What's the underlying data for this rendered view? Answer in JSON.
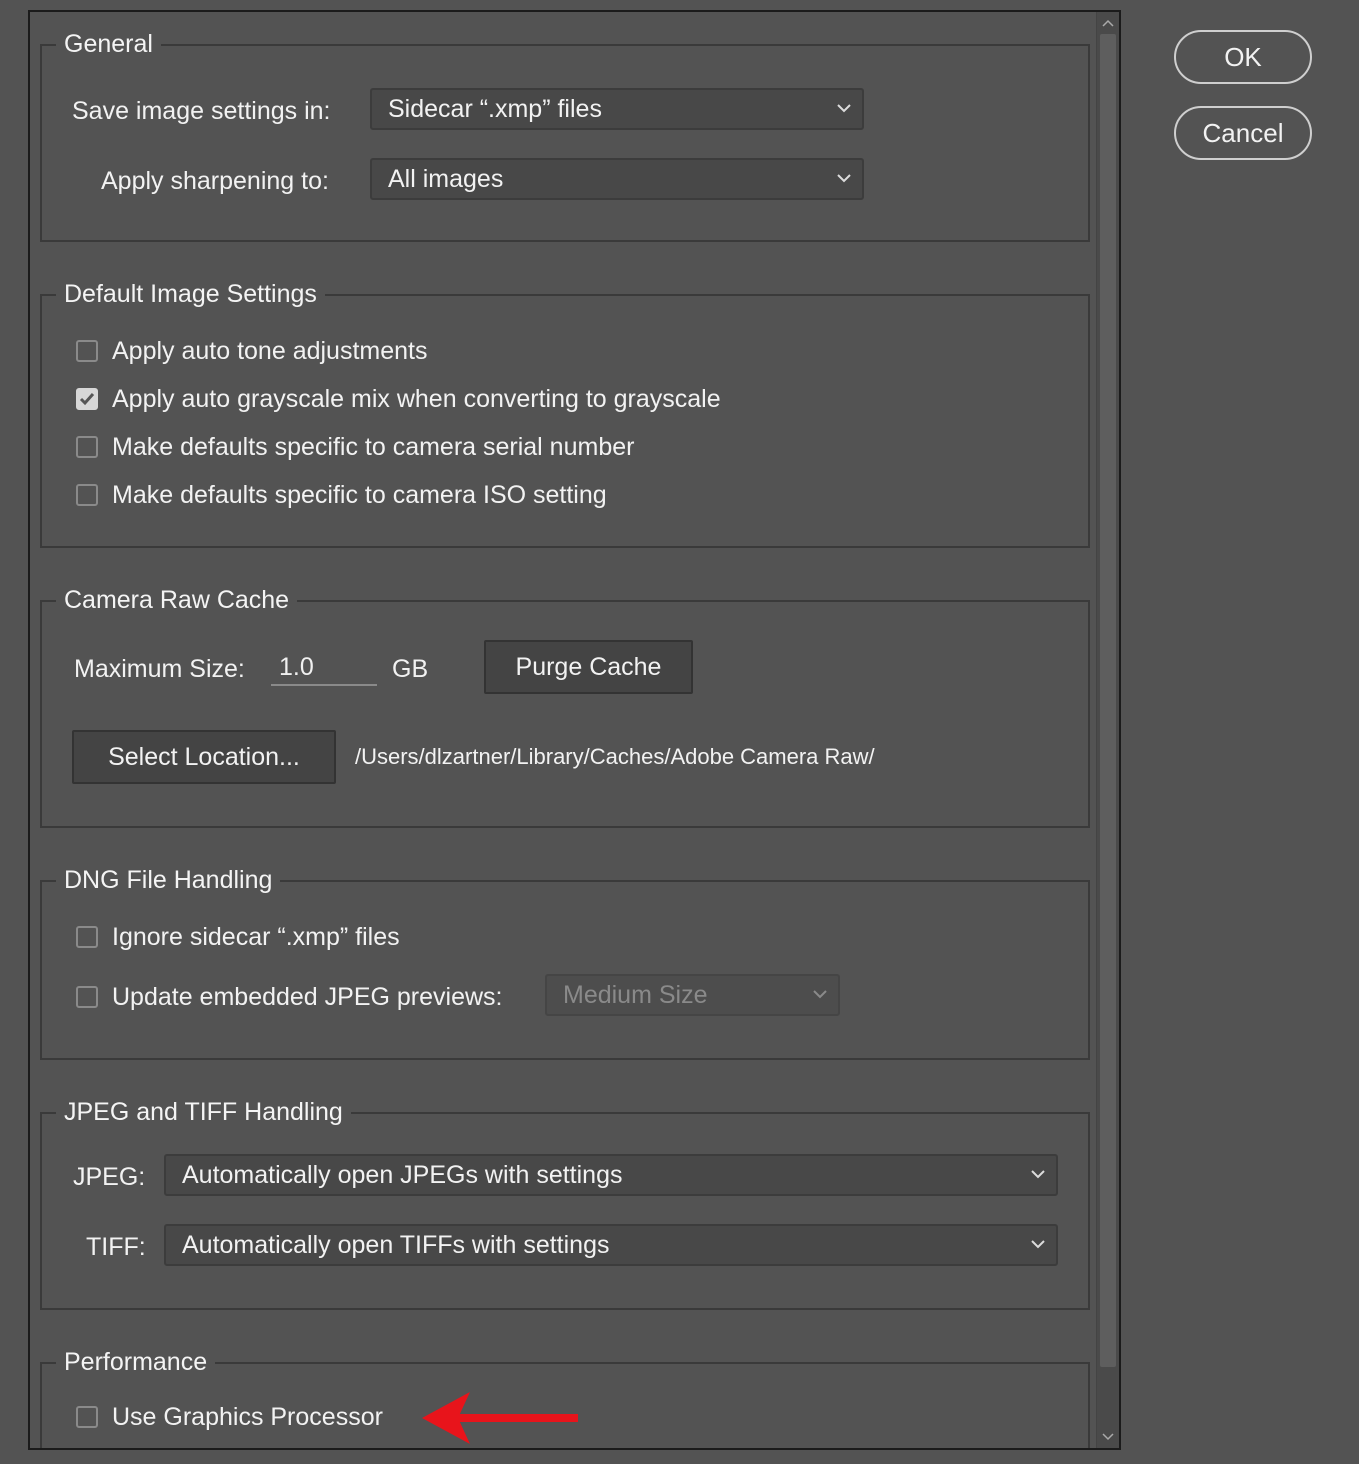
{
  "dialog_buttons": {
    "ok": "OK",
    "cancel": "Cancel"
  },
  "general": {
    "title": "General",
    "save_label": "Save image settings in:",
    "save_value": "Sidecar “.xmp” files",
    "sharpen_label": "Apply sharpening to:",
    "sharpen_value": "All images"
  },
  "default_image": {
    "title": "Default Image Settings",
    "options": [
      {
        "label": "Apply auto tone adjustments",
        "checked": false
      },
      {
        "label": "Apply auto grayscale mix when converting to grayscale",
        "checked": true
      },
      {
        "label": "Make defaults specific to camera serial number",
        "checked": false
      },
      {
        "label": "Make defaults specific to camera ISO setting",
        "checked": false
      }
    ]
  },
  "cache": {
    "title": "Camera Raw Cache",
    "max_label": "Maximum Size:",
    "max_value": "1.0",
    "unit": "GB",
    "purge": "Purge Cache",
    "select_location": "Select Location...",
    "path": "/Users/dlzartner/Library/Caches/Adobe Camera Raw/"
  },
  "dng": {
    "title": "DNG File Handling",
    "ignore_label": "Ignore sidecar “.xmp” files",
    "update_label": "Update embedded JPEG previews:",
    "preview_value": "Medium Size"
  },
  "jpeg_tiff": {
    "title": "JPEG and TIFF Handling",
    "jpeg_label": "JPEG:",
    "jpeg_value": "Automatically open JPEGs with settings",
    "tiff_label": "TIFF:",
    "tiff_value": "Automatically open TIFFs with settings"
  },
  "performance": {
    "title": "Performance",
    "gpu_label": "Use Graphics Processor"
  },
  "colors": {
    "annotation_arrow": "#e8141b"
  }
}
